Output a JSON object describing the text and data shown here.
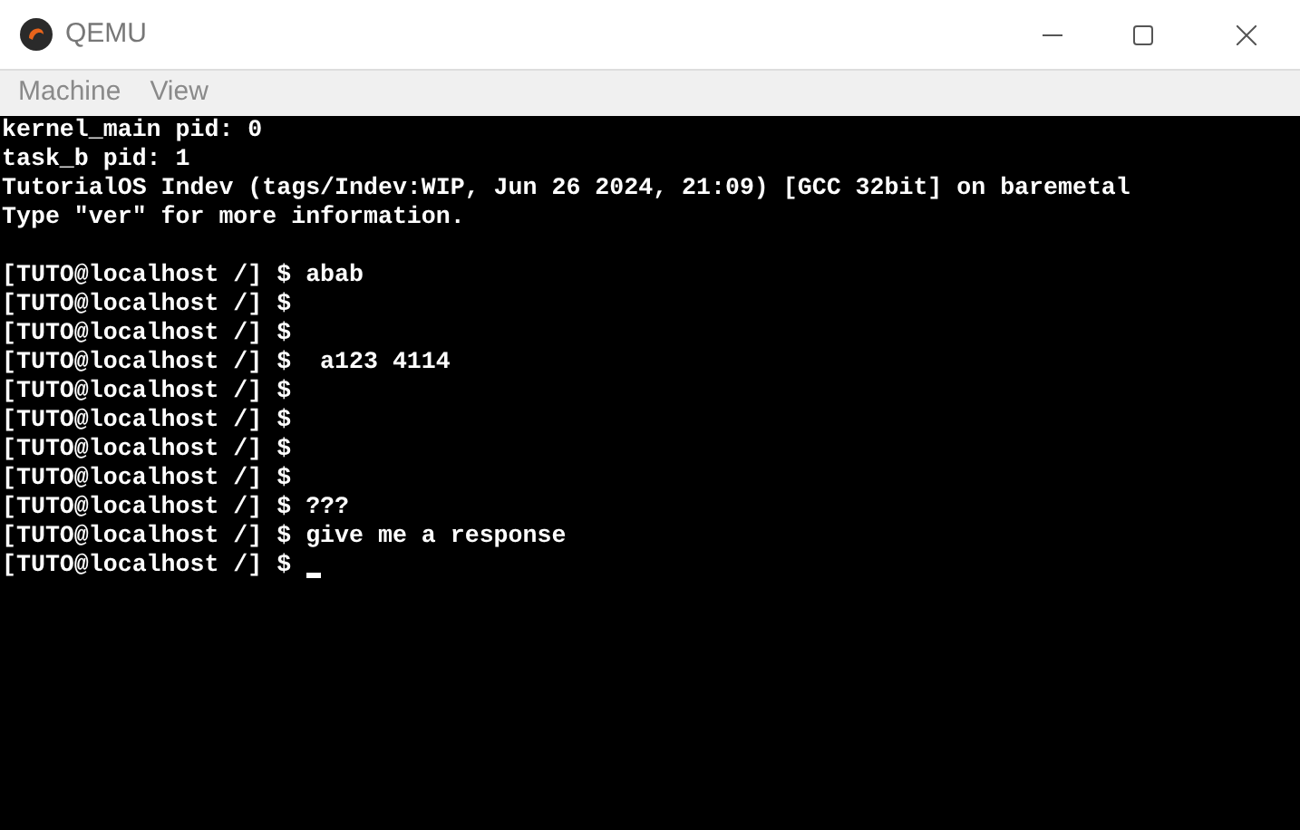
{
  "window": {
    "title": "QEMU"
  },
  "menu": [
    {
      "label": "Machine"
    },
    {
      "label": "View"
    }
  ],
  "terminal": {
    "boot_lines": [
      "kernel_main pid: 0",
      "task_b pid: 1",
      "TutorialOS Indev (tags/Indev:WIP, Jun 26 2024, 21:09) [GCC 32bit] on baremetal",
      "Type \"ver\" for more information."
    ],
    "prompt_lines": [
      "[TUTO@localhost /] $ abab",
      "[TUTO@localhost /] $",
      "[TUTO@localhost /] $",
      "[TUTO@localhost /] $  a123 4114",
      "[TUTO@localhost /] $",
      "[TUTO@localhost /] $",
      "[TUTO@localhost /] $",
      "[TUTO@localhost /] $",
      "[TUTO@localhost /] $ ???",
      "[TUTO@localhost /] $ give me a response",
      "[TUTO@localhost /] $"
    ],
    "cursor": true
  }
}
